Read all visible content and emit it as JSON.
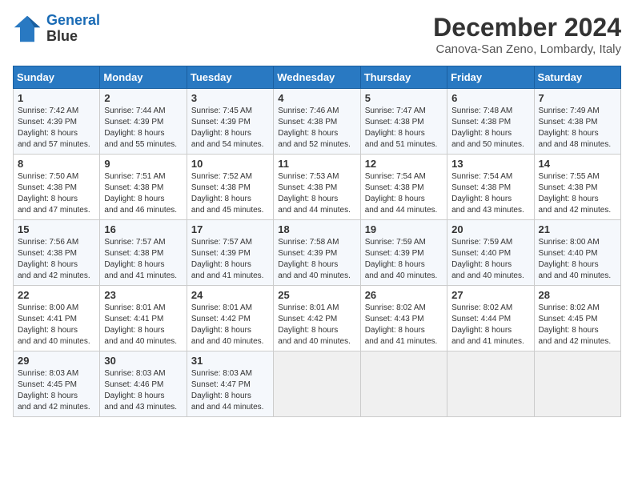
{
  "header": {
    "logo_line1": "General",
    "logo_line2": "Blue",
    "month": "December 2024",
    "location": "Canova-San Zeno, Lombardy, Italy"
  },
  "weekdays": [
    "Sunday",
    "Monday",
    "Tuesday",
    "Wednesday",
    "Thursday",
    "Friday",
    "Saturday"
  ],
  "weeks": [
    [
      {
        "day": "1",
        "sunrise": "7:42 AM",
        "sunset": "4:39 PM",
        "daylight": "8 hours and 57 minutes."
      },
      {
        "day": "2",
        "sunrise": "7:44 AM",
        "sunset": "4:39 PM",
        "daylight": "8 hours and 55 minutes."
      },
      {
        "day": "3",
        "sunrise": "7:45 AM",
        "sunset": "4:39 PM",
        "daylight": "8 hours and 54 minutes."
      },
      {
        "day": "4",
        "sunrise": "7:46 AM",
        "sunset": "4:38 PM",
        "daylight": "8 hours and 52 minutes."
      },
      {
        "day": "5",
        "sunrise": "7:47 AM",
        "sunset": "4:38 PM",
        "daylight": "8 hours and 51 minutes."
      },
      {
        "day": "6",
        "sunrise": "7:48 AM",
        "sunset": "4:38 PM",
        "daylight": "8 hours and 50 minutes."
      },
      {
        "day": "7",
        "sunrise": "7:49 AM",
        "sunset": "4:38 PM",
        "daylight": "8 hours and 48 minutes."
      }
    ],
    [
      {
        "day": "8",
        "sunrise": "7:50 AM",
        "sunset": "4:38 PM",
        "daylight": "8 hours and 47 minutes."
      },
      {
        "day": "9",
        "sunrise": "7:51 AM",
        "sunset": "4:38 PM",
        "daylight": "8 hours and 46 minutes."
      },
      {
        "day": "10",
        "sunrise": "7:52 AM",
        "sunset": "4:38 PM",
        "daylight": "8 hours and 45 minutes."
      },
      {
        "day": "11",
        "sunrise": "7:53 AM",
        "sunset": "4:38 PM",
        "daylight": "8 hours and 44 minutes."
      },
      {
        "day": "12",
        "sunrise": "7:54 AM",
        "sunset": "4:38 PM",
        "daylight": "8 hours and 44 minutes."
      },
      {
        "day": "13",
        "sunrise": "7:54 AM",
        "sunset": "4:38 PM",
        "daylight": "8 hours and 43 minutes."
      },
      {
        "day": "14",
        "sunrise": "7:55 AM",
        "sunset": "4:38 PM",
        "daylight": "8 hours and 42 minutes."
      }
    ],
    [
      {
        "day": "15",
        "sunrise": "7:56 AM",
        "sunset": "4:38 PM",
        "daylight": "8 hours and 42 minutes."
      },
      {
        "day": "16",
        "sunrise": "7:57 AM",
        "sunset": "4:38 PM",
        "daylight": "8 hours and 41 minutes."
      },
      {
        "day": "17",
        "sunrise": "7:57 AM",
        "sunset": "4:39 PM",
        "daylight": "8 hours and 41 minutes."
      },
      {
        "day": "18",
        "sunrise": "7:58 AM",
        "sunset": "4:39 PM",
        "daylight": "8 hours and 40 minutes."
      },
      {
        "day": "19",
        "sunrise": "7:59 AM",
        "sunset": "4:39 PM",
        "daylight": "8 hours and 40 minutes."
      },
      {
        "day": "20",
        "sunrise": "7:59 AM",
        "sunset": "4:40 PM",
        "daylight": "8 hours and 40 minutes."
      },
      {
        "day": "21",
        "sunrise": "8:00 AM",
        "sunset": "4:40 PM",
        "daylight": "8 hours and 40 minutes."
      }
    ],
    [
      {
        "day": "22",
        "sunrise": "8:00 AM",
        "sunset": "4:41 PM",
        "daylight": "8 hours and 40 minutes."
      },
      {
        "day": "23",
        "sunrise": "8:01 AM",
        "sunset": "4:41 PM",
        "daylight": "8 hours and 40 minutes."
      },
      {
        "day": "24",
        "sunrise": "8:01 AM",
        "sunset": "4:42 PM",
        "daylight": "8 hours and 40 minutes."
      },
      {
        "day": "25",
        "sunrise": "8:01 AM",
        "sunset": "4:42 PM",
        "daylight": "8 hours and 40 minutes."
      },
      {
        "day": "26",
        "sunrise": "8:02 AM",
        "sunset": "4:43 PM",
        "daylight": "8 hours and 41 minutes."
      },
      {
        "day": "27",
        "sunrise": "8:02 AM",
        "sunset": "4:44 PM",
        "daylight": "8 hours and 41 minutes."
      },
      {
        "day": "28",
        "sunrise": "8:02 AM",
        "sunset": "4:45 PM",
        "daylight": "8 hours and 42 minutes."
      }
    ],
    [
      {
        "day": "29",
        "sunrise": "8:03 AM",
        "sunset": "4:45 PM",
        "daylight": "8 hours and 42 minutes."
      },
      {
        "day": "30",
        "sunrise": "8:03 AM",
        "sunset": "4:46 PM",
        "daylight": "8 hours and 43 minutes."
      },
      {
        "day": "31",
        "sunrise": "8:03 AM",
        "sunset": "4:47 PM",
        "daylight": "8 hours and 44 minutes."
      },
      null,
      null,
      null,
      null
    ]
  ]
}
